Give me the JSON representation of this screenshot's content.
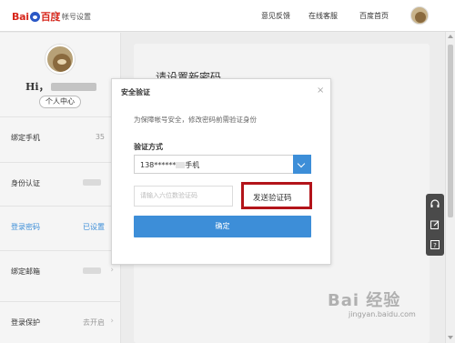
{
  "header": {
    "logo_text_left": "Bai",
    "logo_text_right": "百度",
    "sub_title": "帐号设置",
    "nav": [
      "意见反馈",
      "在线客服",
      "百度首页"
    ]
  },
  "sidebar": {
    "greeting": "Hi，",
    "personal_center": "个人中心",
    "items": [
      {
        "label": "绑定手机",
        "value": "35"
      },
      {
        "label": "身份认证",
        "value": ""
      },
      {
        "label": "登录密码",
        "value": "已设置"
      },
      {
        "label": "绑定邮箱",
        "value": ""
      },
      {
        "label": "登录保护",
        "value": "去开启"
      }
    ]
  },
  "main": {
    "title": "请设置新密码"
  },
  "dialog": {
    "title": "安全验证",
    "close": "×",
    "description": "为保障帐号安全，修改密码前需验证身份",
    "method_label": "验证方式",
    "phone_prefix": "138******",
    "phone_suffix": "手机",
    "code_placeholder": "请输入六位数验证码",
    "send_button": "发送验证码",
    "confirm_button": "确定"
  },
  "side_tools": [
    "headset-icon",
    "edit-icon",
    "help-icon"
  ],
  "colors": {
    "accent": "#3d8ed8",
    "highlight_box": "#b3141a",
    "brand_red": "#d7261b"
  },
  "watermark": {
    "text": "Bai 经验",
    "url": "jingyan.baidu.com"
  }
}
